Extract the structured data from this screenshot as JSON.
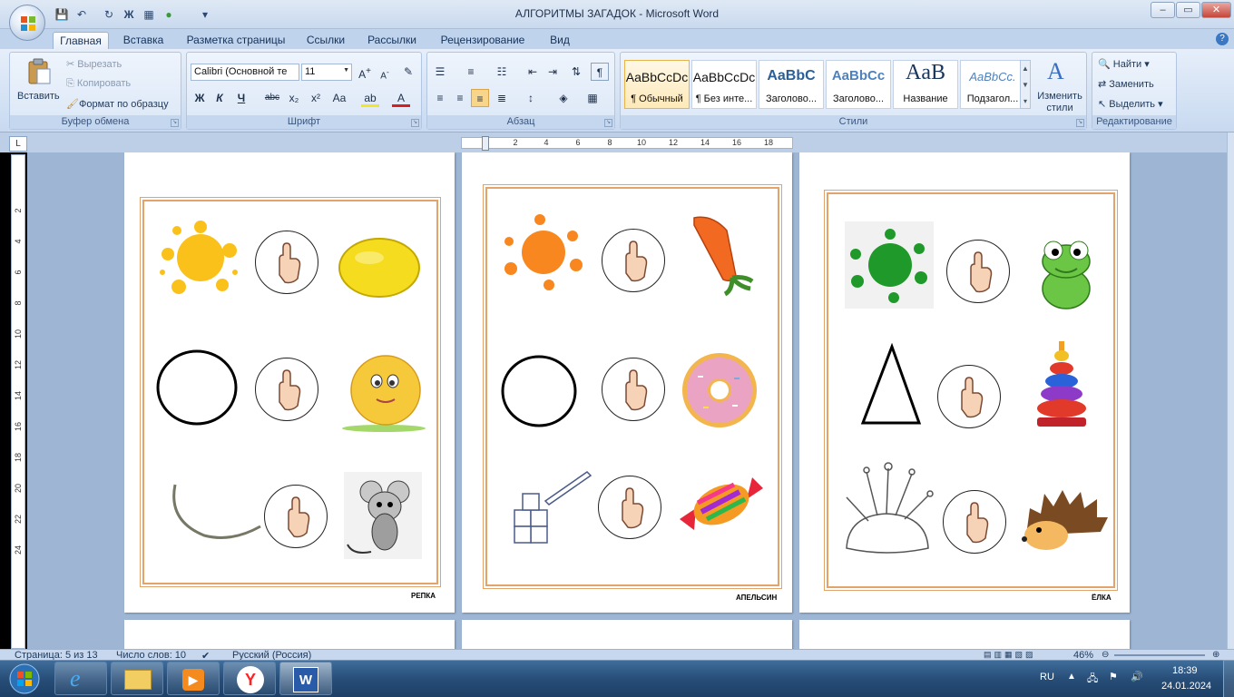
{
  "window": {
    "title": "АЛГОРИТМЫ ЗАГАДОК - Microsoft Word",
    "minimize": "–",
    "restore": "▭",
    "close": "✕"
  },
  "tabs": [
    "Главная",
    "Вставка",
    "Разметка страницы",
    "Ссылки",
    "Рассылки",
    "Рецензирование",
    "Вид"
  ],
  "clipboard": {
    "paste": "Вставить",
    "cut": "Вырезать",
    "copy": "Копировать",
    "format_painter": "Формат по образцу",
    "label": "Буфер обмена"
  },
  "font": {
    "name": "Calibri (Основной те",
    "size": "11",
    "label": "Шрифт",
    "bold": "Ж",
    "italic": "К",
    "underline": "Ч",
    "strike": "abc",
    "sub": "x₂",
    "sup": "x²",
    "case": "Aa"
  },
  "paragraph": {
    "label": "Абзац"
  },
  "styles": {
    "label": "Стили",
    "items": [
      {
        "sample": "AaBbCcDc",
        "name": "¶ Обычный"
      },
      {
        "sample": "AaBbCcDc",
        "name": "¶ Без инте..."
      },
      {
        "sample": "AaBbC",
        "name": "Заголово..."
      },
      {
        "sample": "AaBbCc",
        "name": "Заголово..."
      },
      {
        "sample": "AaB",
        "name": "Название"
      },
      {
        "sample": "AaBbCc.",
        "name": "Подзагол..."
      }
    ],
    "change": "Изменить стили"
  },
  "editing": {
    "label": "Редактирование",
    "find": "Найти",
    "replace": "Заменить",
    "select": "Выделить"
  },
  "ruler": {
    "ticks": [
      "2",
      "4",
      "6",
      "8",
      "10",
      "12",
      "14",
      "16",
      "18"
    ],
    "vticks": [
      "2",
      "4",
      "6",
      "8",
      "10",
      "12",
      "14",
      "16",
      "18",
      "20",
      "22",
      "24"
    ]
  },
  "pages": [
    {
      "label": "РЕПКА"
    },
    {
      "label": "АПЕЛЬСИН"
    },
    {
      "label": "ЁЛКА"
    }
  ],
  "status": {
    "page": "Страница: 5 из 13",
    "words": "Число слов: 10",
    "lang": "Русский (Россия)",
    "zoom": "46%"
  },
  "tray": {
    "lang": "RU",
    "time": "18:39",
    "date": "24.01.2024"
  }
}
